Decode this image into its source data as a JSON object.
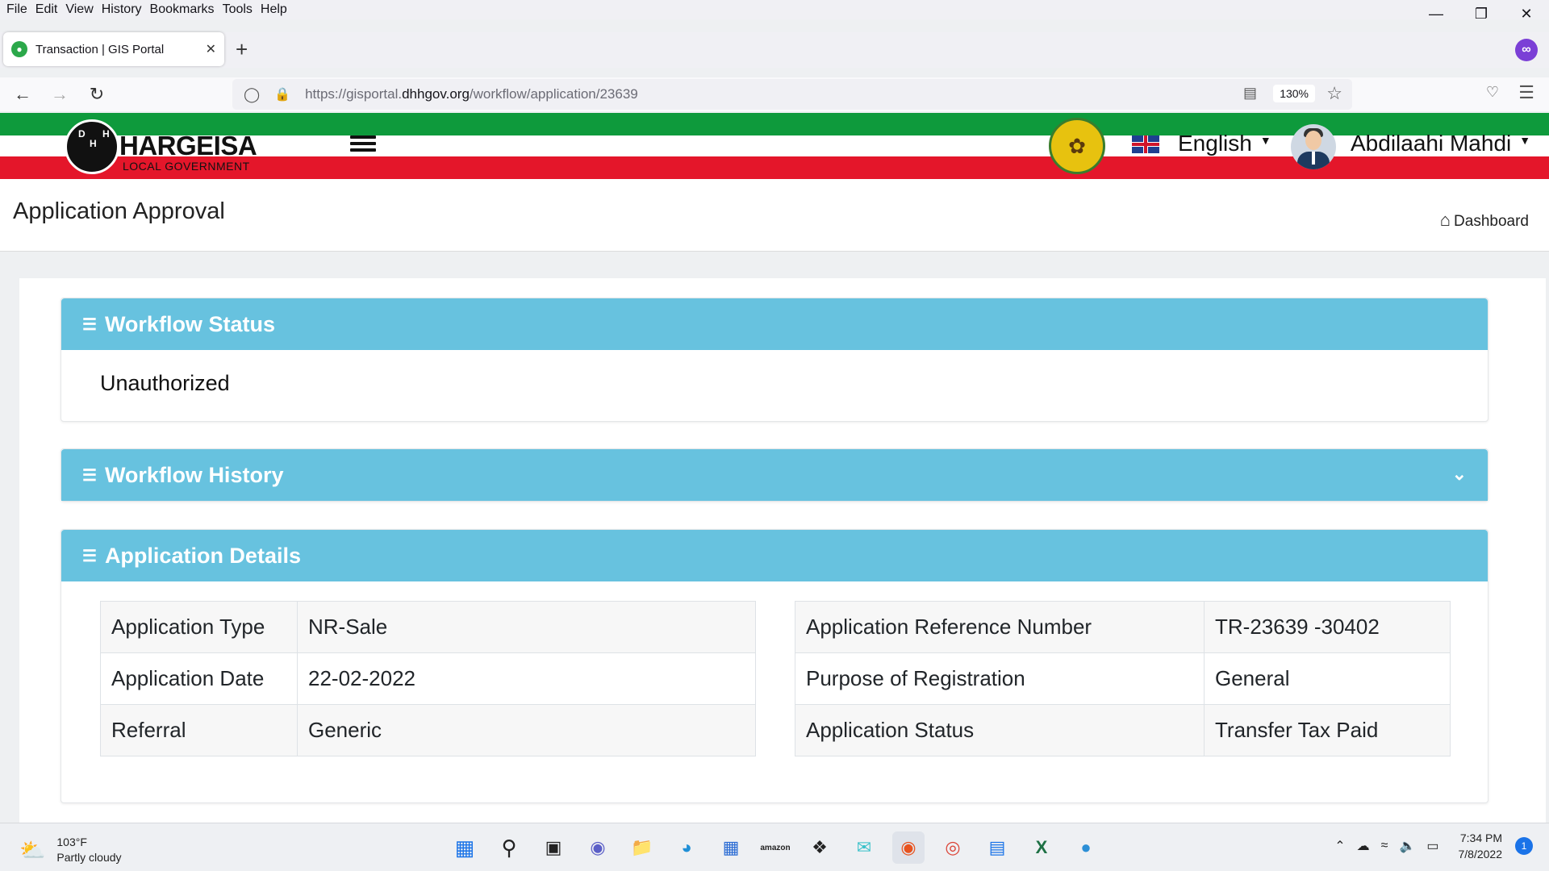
{
  "browser": {
    "menu": [
      "File",
      "Edit",
      "View",
      "History",
      "Bookmarks",
      "Tools",
      "Help"
    ],
    "tab_title": "Transaction | GIS Portal",
    "url_prefix": "https://gisportal.",
    "url_host": "dhhgov.org",
    "url_path": "/workflow/application/23639",
    "zoom": "130%"
  },
  "site": {
    "logo_name": "HARGEISA",
    "logo_sub": "LOCAL GOVERNMENT",
    "logo_initials": [
      "D",
      "H",
      "H"
    ],
    "language": "English",
    "user_name": "Abdilaahi Mahdi",
    "colors": {
      "green": "#0e9a3c",
      "red": "#e4162a",
      "card_header": "#67c2df"
    }
  },
  "page": {
    "title": "Application Approval",
    "breadcrumb": "Dashboard"
  },
  "workflow_status": {
    "title": "Workflow Status",
    "value": "Unauthorized"
  },
  "workflow_history": {
    "title": "Workflow History"
  },
  "application_details": {
    "title": "Application Details",
    "left": [
      {
        "label": "Application Type",
        "value": "NR-Sale"
      },
      {
        "label": "Application Date",
        "value": "22-02-2022"
      },
      {
        "label": "Referral",
        "value": "Generic"
      }
    ],
    "right": [
      {
        "label": "Application Reference Number",
        "value": "TR-23639 -30402"
      },
      {
        "label": "Purpose of Registration",
        "value": "General"
      },
      {
        "label": "Application Status",
        "value": "Transfer Tax Paid"
      }
    ]
  },
  "taskbar": {
    "temperature": "103°F",
    "weather": "Partly cloudy",
    "amazon_label": "amazon",
    "time": "7:34 PM",
    "date": "7/8/2022",
    "notifications": "1"
  }
}
